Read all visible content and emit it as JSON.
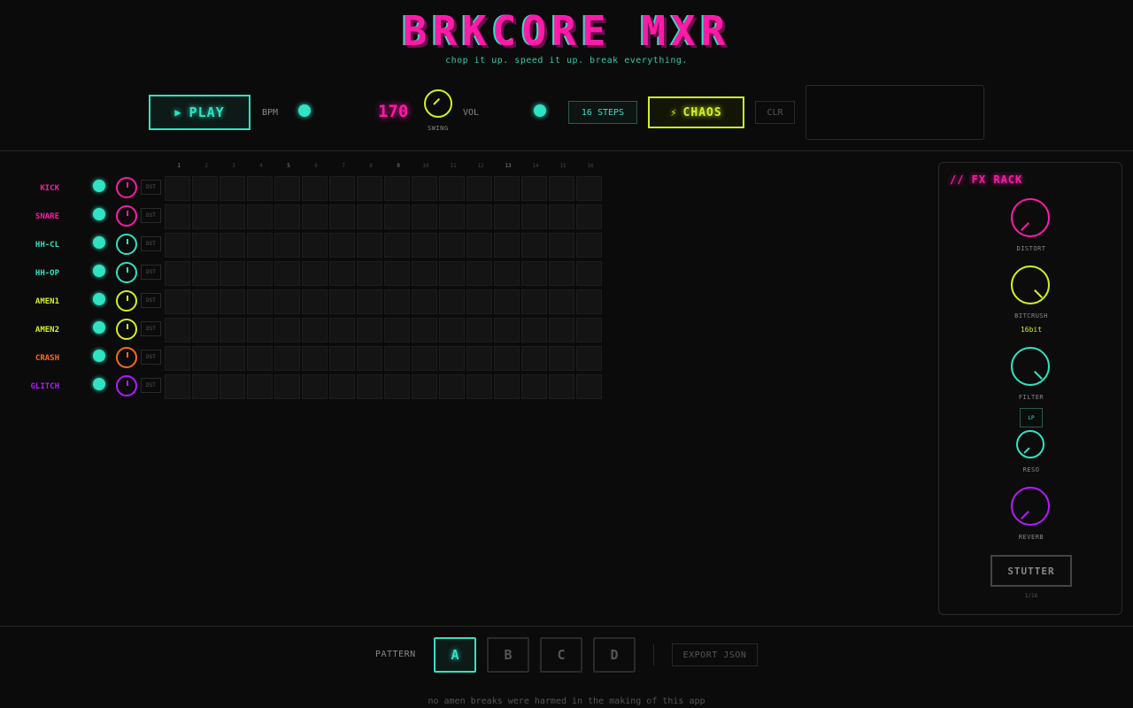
{
  "header": {
    "title": "BRKCORE MXR",
    "subtitle": "chop it up. speed it up. break everything."
  },
  "toolbar": {
    "play_label": "PLAY",
    "play_icon": "play-icon",
    "bpm_label": "BPM",
    "bpm_value": "170",
    "swing_label": "SWING",
    "vol_label": "VOL",
    "steps_label": "16 STEPS",
    "chaos_label": "CHAOS",
    "chaos_icon": "lightning-icon",
    "clear_label": "CLR"
  },
  "sequencer": {
    "step_numbers": [
      "1",
      "2",
      "3",
      "4",
      "5",
      "6",
      "7",
      "8",
      "9",
      "10",
      "11",
      "12",
      "13",
      "14",
      "15",
      "16"
    ],
    "dst_label": "DST",
    "tracks": [
      {
        "name": "KICK",
        "color": "#ff1aa8"
      },
      {
        "name": "SNARE",
        "color": "#ff1aa8"
      },
      {
        "name": "HH-CL",
        "color": "#2fe3c3"
      },
      {
        "name": "HH-OP",
        "color": "#2fe3c3"
      },
      {
        "name": "AMEN1",
        "color": "#d4f01e"
      },
      {
        "name": "AMEN2",
        "color": "#d4f01e"
      },
      {
        "name": "CRASH",
        "color": "#ff6a1a"
      },
      {
        "name": "GLITCH",
        "color": "#b41aff"
      }
    ]
  },
  "fx_rack": {
    "title": "// FX RACK",
    "distort_label": "DISTORT",
    "bitcrush_label": "BITCRUSH",
    "bitcrush_value": "16bit",
    "filter_label": "FILTER",
    "filter_mode": "LP",
    "reso_label": "RESO",
    "reverb_label": "REVERB",
    "stutter_label": "STUTTER",
    "stutter_value": "1/16"
  },
  "bottom": {
    "pattern_label": "PATTERN",
    "patterns": [
      "A",
      "B",
      "C",
      "D"
    ],
    "active_pattern": "A",
    "export_label": "EXPORT JSON",
    "footer": "no amen breaks were harmed in the making of this app"
  },
  "colors": {
    "pink": "#ff1aa8",
    "cyan": "#2fe3c3",
    "yellow": "#d4f01e",
    "orange": "#ff6a1a",
    "purple": "#b41aff"
  }
}
